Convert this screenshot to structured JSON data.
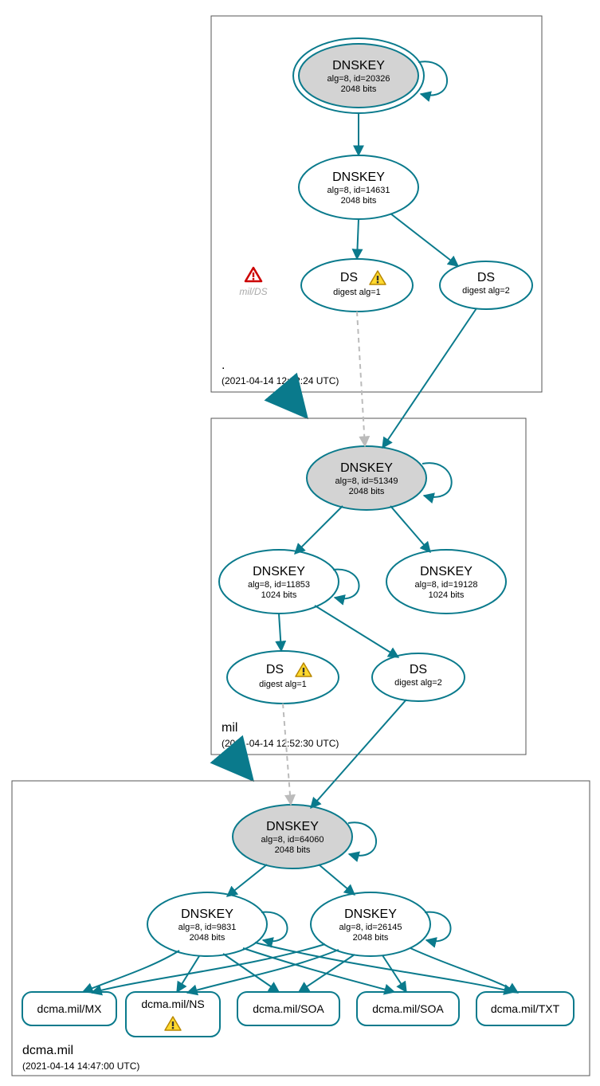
{
  "colors": {
    "teal": "#0a7a8c",
    "grey": "#bbbbbb",
    "shade": "#d3d3d3"
  },
  "zones": {
    "root": {
      "name": ".",
      "time": "(2021-04-14 12:22:24 UTC)"
    },
    "mil": {
      "name": "mil",
      "time": "(2021-04-14 12:52:30 UTC)"
    },
    "dcma": {
      "name": "dcma.mil",
      "time": "(2021-04-14 14:47:00 UTC)"
    }
  },
  "nodes": {
    "root_ksk": {
      "title": "DNSKEY",
      "sub1": "alg=8, id=20326",
      "sub2": "2048 bits"
    },
    "root_zsk": {
      "title": "DNSKEY",
      "sub1": "alg=8, id=14631",
      "sub2": "2048 bits"
    },
    "root_ds1": {
      "title": "DS",
      "sub1": "digest alg=1"
    },
    "root_ds2": {
      "title": "DS",
      "sub1": "digest alg=2"
    },
    "root_warn": {
      "label": "mil/DS"
    },
    "mil_ksk": {
      "title": "DNSKEY",
      "sub1": "alg=8, id=51349",
      "sub2": "2048 bits"
    },
    "mil_zsk1": {
      "title": "DNSKEY",
      "sub1": "alg=8, id=11853",
      "sub2": "1024 bits"
    },
    "mil_zsk2": {
      "title": "DNSKEY",
      "sub1": "alg=8, id=19128",
      "sub2": "1024 bits"
    },
    "mil_ds1": {
      "title": "DS",
      "sub1": "digest alg=1"
    },
    "mil_ds2": {
      "title": "DS",
      "sub1": "digest alg=2"
    },
    "dcma_ksk": {
      "title": "DNSKEY",
      "sub1": "alg=8, id=64060",
      "sub2": "2048 bits"
    },
    "dcma_zsk1": {
      "title": "DNSKEY",
      "sub1": "alg=8, id=9831",
      "sub2": "2048 bits"
    },
    "dcma_zsk2": {
      "title": "DNSKEY",
      "sub1": "alg=8, id=26145",
      "sub2": "2048 bits"
    },
    "rr_mx": {
      "label": "dcma.mil/MX"
    },
    "rr_ns": {
      "label": "dcma.mil/NS"
    },
    "rr_soa1": {
      "label": "dcma.mil/SOA"
    },
    "rr_soa2": {
      "label": "dcma.mil/SOA"
    },
    "rr_txt": {
      "label": "dcma.mil/TXT"
    }
  }
}
